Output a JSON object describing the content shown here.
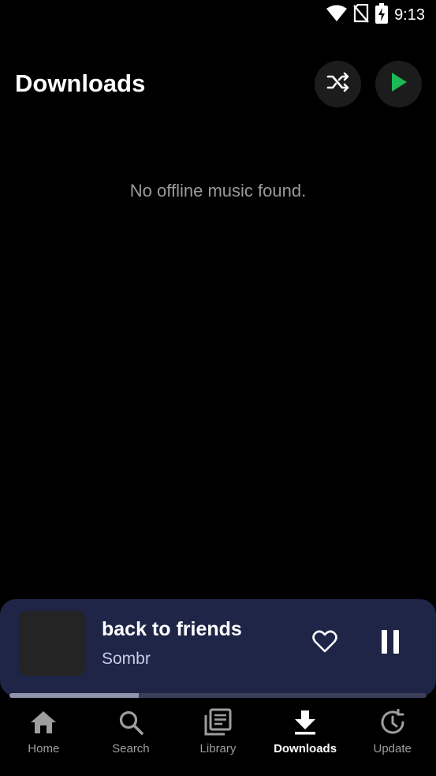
{
  "status_bar": {
    "time": "9:13",
    "icons": [
      "wifi-icon",
      "no-sim-icon",
      "battery-charging-icon"
    ]
  },
  "header": {
    "title": "Downloads",
    "shuffle_icon": "shuffle-icon",
    "play_icon": "play-icon"
  },
  "main": {
    "empty_message": "No offline music found."
  },
  "mini_player": {
    "title": "back to friends",
    "artist": "Sombr",
    "progress": 0.31,
    "like_icon": "heart-outline-icon",
    "pause_icon": "pause-icon"
  },
  "bottom_nav": {
    "items": [
      {
        "label": "Home",
        "icon": "home-icon"
      },
      {
        "label": "Search",
        "icon": "search-icon"
      },
      {
        "label": "Library",
        "icon": "library-icon"
      },
      {
        "label": "Downloads",
        "icon": "download-icon",
        "active": true
      },
      {
        "label": "Update",
        "icon": "update-icon"
      }
    ]
  },
  "colors": {
    "background": "#000000",
    "player_background": "#1e2547",
    "accent_green": "#1db954",
    "inactive": "#9e9e9e"
  }
}
